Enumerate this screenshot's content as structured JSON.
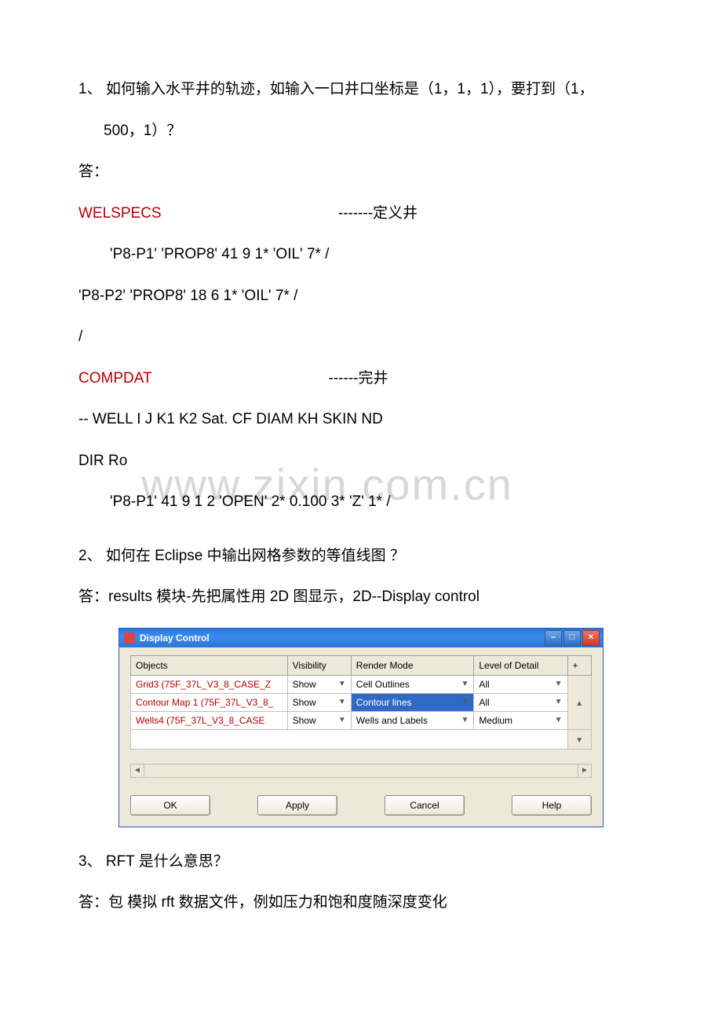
{
  "watermark": "www.zixin.com.cn",
  "q1": {
    "line1": "1、 如何输入水平井的轨迹，如输入一口井口坐标是（1，1，1），要打到（1，",
    "line2": "500，1）？",
    "ans": "答：",
    "welspecs": "WELSPECS",
    "welspecs_cmt": "-------定义井",
    "ws1": "'P8-P1'    'PROP8'   41   9  1*      'OIL'  7* /",
    "ws2": "'P8-P2'    'PROP8'   18   6  1*      'OIL'  7* /",
    "slash": "/",
    "compdat": "COMPDAT",
    "compdat_cmt": "------完井",
    "cd_hdr": "-- WELL      I    J    K1  K2           Sat.        CF       DIAM        KH SKIN ND",
    "cd_hdr2": "DIR   Ro",
    "cd1": "'P8-P1'  41   9     1    2    'OPEN'  2*    0.100    3*         'Z'     1* /"
  },
  "q2": {
    "q": "2、 如何在 Eclipse 中输出网格参数的等值线图  ？",
    "a": "答：results 模块-先把属性用 2D 图显示，2D--Display control"
  },
  "dialog": {
    "title": "Display Control",
    "min": "–",
    "max": "□",
    "close": "×",
    "headers": [
      "Objects",
      "Visibility",
      "Render Mode",
      "Level of Detail"
    ],
    "plus": "+",
    "rows": [
      {
        "obj": "Grid3 (75F_37L_V3_8_CASE_Z",
        "vis": "Show",
        "render": "Cell Outlines",
        "lod": "All"
      },
      {
        "obj": "Contour Map 1 (75F_37L_V3_8_",
        "vis": "Show",
        "render": "Contour lines",
        "lod": "All",
        "sel": true
      },
      {
        "obj": "Wells4  (75F_37L_V3_8_CASE",
        "vis": "Show",
        "render": "Wells and Labels",
        "lod": "Medium"
      }
    ],
    "buttons": {
      "ok": "OK",
      "apply": "Apply",
      "cancel": "Cancel",
      "help": "Help"
    }
  },
  "q3": {
    "q": "3、 RFT 是什么意思？",
    "a": "答：包 模拟 rft 数据文件，例如压力和饱和度随深度变化"
  }
}
